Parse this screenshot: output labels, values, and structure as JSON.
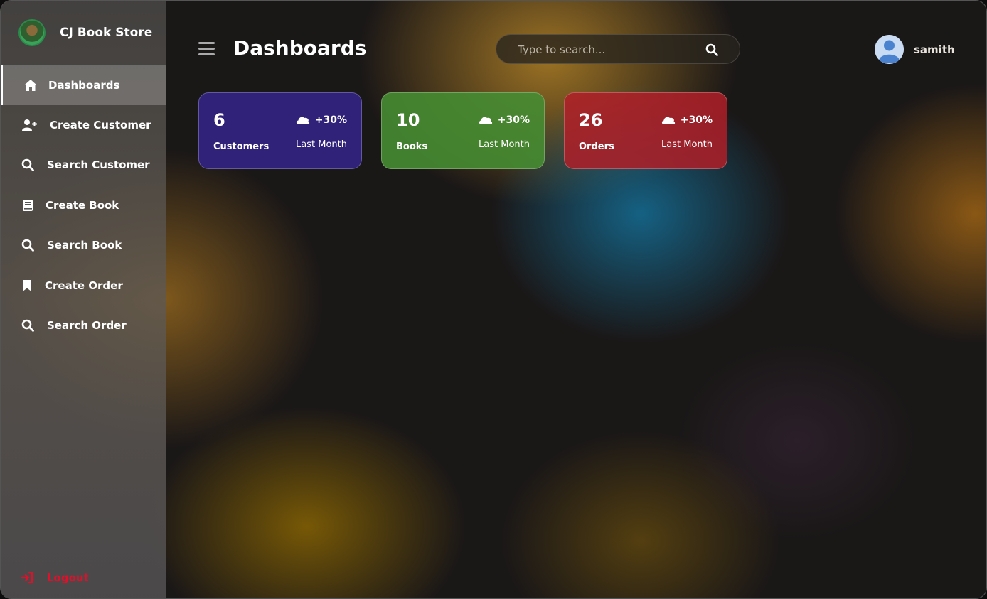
{
  "brand": {
    "name": "CJ Book Store"
  },
  "sidebar": {
    "items": [
      {
        "label": "Dashboards",
        "icon": "home-icon",
        "active": true
      },
      {
        "label": "Create Customer",
        "icon": "user-plus-icon",
        "active": false
      },
      {
        "label": "Search Customer",
        "icon": "search-icon",
        "active": false
      },
      {
        "label": "Create Book",
        "icon": "book-icon",
        "active": false
      },
      {
        "label": "Search Book",
        "icon": "search-icon",
        "active": false
      },
      {
        "label": "Create Order",
        "icon": "bookmark-icon",
        "active": false
      },
      {
        "label": "Search Order",
        "icon": "search-icon",
        "active": false
      }
    ],
    "logout_label": "Logout"
  },
  "header": {
    "title": "Dashboards",
    "search_placeholder": "Type to search...",
    "username": "samith"
  },
  "cards": [
    {
      "value": "6",
      "label": "Customers",
      "delta": "+30%",
      "period": "Last Month",
      "color": "#32238a"
    },
    {
      "value": "10",
      "label": "Books",
      "delta": "+30%",
      "period": "Last Month",
      "color": "#468c32"
    },
    {
      "value": "26",
      "label": "Orders",
      "delta": "+30%",
      "period": "Last Month",
      "color": "#af1e28"
    }
  ],
  "colors": {
    "logout": "#e0102a",
    "active_item_bg": "rgba(255,255,255,0.22)"
  }
}
